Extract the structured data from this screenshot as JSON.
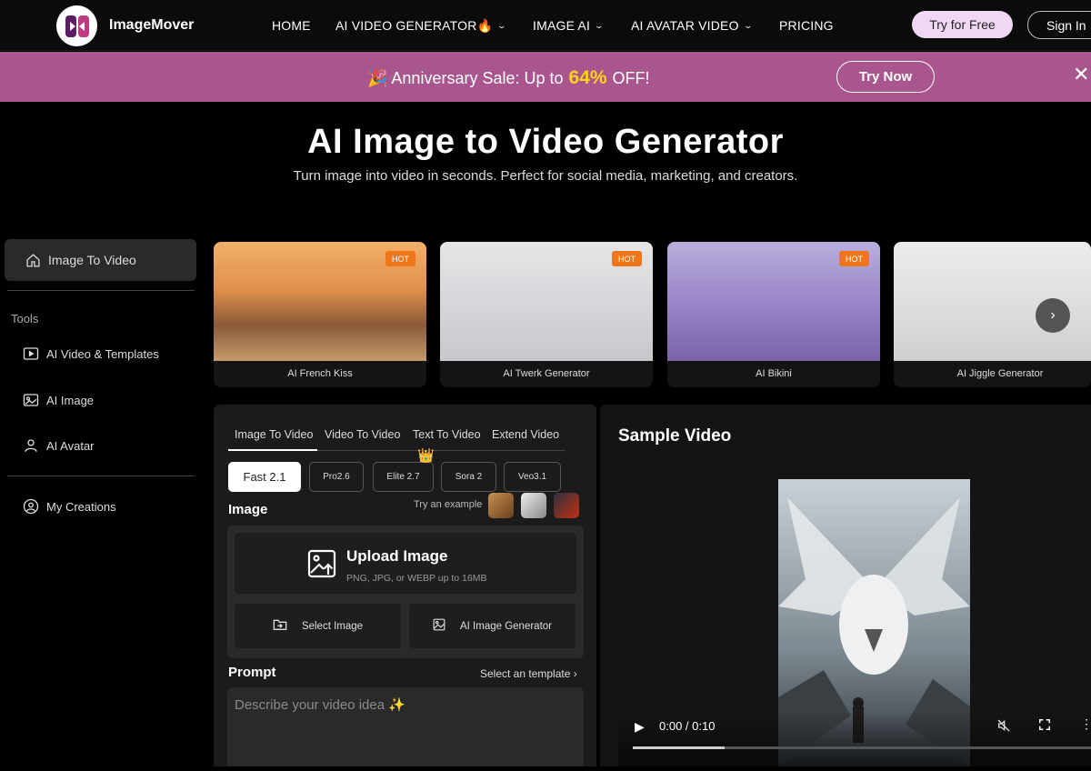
{
  "nav": {
    "brand": "ImageMover",
    "items": [
      "HOME",
      "AI VIDEO GENERATOR🔥",
      "IMAGE AI",
      "AI AVATAR VIDEO",
      "PRICING"
    ],
    "try_free": "Try for Free",
    "sign_in": "Sign In"
  },
  "banner": {
    "text_pre": "🎉 Anniversary Sale: Up to",
    "percent": "64%",
    "text_post": "OFF!",
    "cta": "Try Now",
    "close": "✕"
  },
  "hero": {
    "title": "AI Image to Video Generator",
    "subtitle": "Turn image into video in seconds. Perfect for social media, marketing, and creators."
  },
  "sidebar": {
    "active": "Image To Video",
    "section": "Tools",
    "items": [
      "AI Video & Templates",
      "AI Image",
      "AI Avatar"
    ],
    "creations": "My Creations"
  },
  "cards": [
    {
      "label": "AI French Kiss",
      "badge": "HOT"
    },
    {
      "label": "AI Twerk Generator",
      "badge": "HOT"
    },
    {
      "label": "AI Bikini",
      "badge": "HOT"
    },
    {
      "label": "AI Jiggle Generator",
      "badge": ""
    }
  ],
  "panel": {
    "tabs": [
      "Image To Video",
      "Video To Video",
      "Text To Video",
      "Extend Video"
    ],
    "models": [
      "Fast 2.1",
      "Pro2.6",
      "Elite 2.7",
      "Sora 2",
      "Veo3.1"
    ],
    "image_label": "Image",
    "try_example": "Try an example",
    "upload_title": "Upload Image",
    "upload_sub": "PNG, JPG, or WEBP up to 16MB",
    "select_image": "Select Image",
    "ai_image_generator": "AI Image Generator",
    "prompt_label": "Prompt",
    "select_template": "Select an template",
    "prompt_placeholder": "Describe your video idea ✨"
  },
  "video": {
    "title": "Sample Video",
    "time": "0:00 / 0:10",
    "progress": 0.2
  }
}
